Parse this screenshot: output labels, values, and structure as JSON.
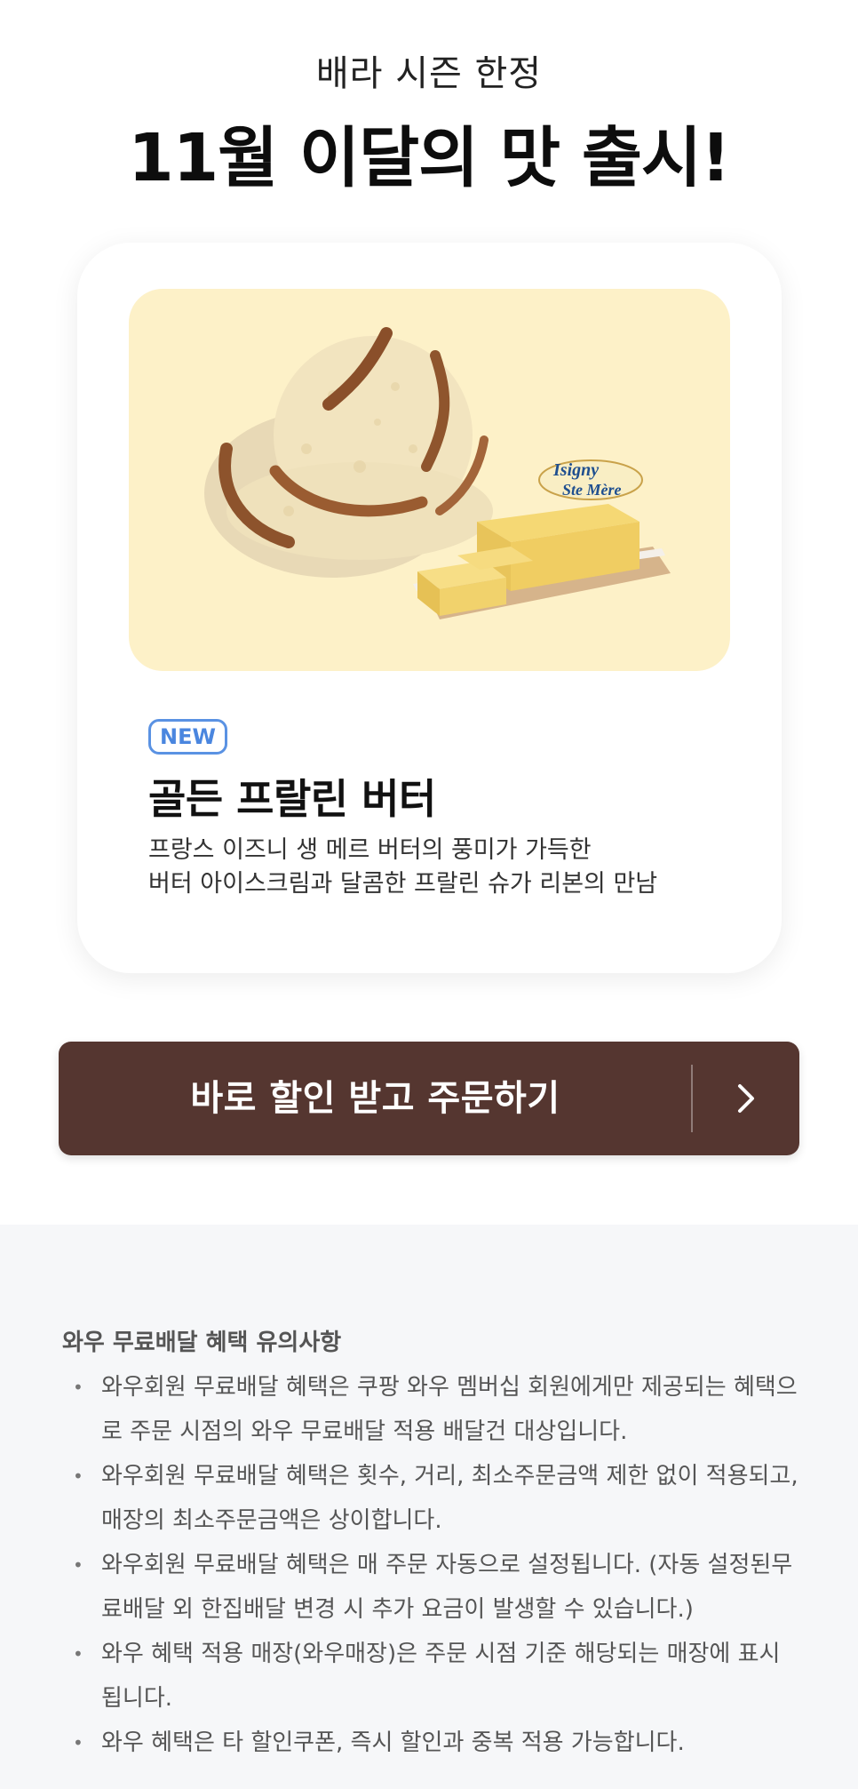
{
  "hero": {
    "subtitle": "배라 시즌 한정",
    "title": "11월 이달의 맛 출시!"
  },
  "product": {
    "badge": "NEW",
    "name": "골든 프랄린 버터",
    "desc_line1": "프랑스 이즈니 생 메르 버터의 풍미가 가득한",
    "desc_line2": "버터 아이스크림과 달콤한 프랄린 슈가 리본의 만남",
    "brand_logo_text": "Isigny Ste Mère"
  },
  "order": {
    "label": "바로 할인 받고 주문하기",
    "arrow_icon": "chevron-right-icon"
  },
  "notice": {
    "title": "와우 무료배달 혜택 유의사항",
    "items": [
      "와우회원 무료배달 혜택은 쿠팡 와우 멤버십 회원에게만 제공되는 혜택으로 주문 시점의 와우 무료배달 적용 배달건 대상입니다.",
      "와우회원 무료배달 혜택은 횟수, 거리, 최소주문금액 제한 없이 적용되고, 매장의 최소주문금액은 상이합니다.",
      "와우회원 무료배달 혜택은 매 주문 자동으로 설정됩니다. (자동 설정된무료배달 외 한집배달 변경 시 추가 요금이 발생할 수 있습니다.)",
      "와우 혜택 적용 매장(와우매장)은 주문 시점 기준 해당되는 매장에 표시됩니다.",
      "와우 혜택은 타 할인쿠폰, 즉시 할인과 중복 적용 가능합니다."
    ]
  },
  "colors": {
    "button_bg": "#553630",
    "badge": "#4a86df",
    "image_bg": "#fdf1c8"
  }
}
